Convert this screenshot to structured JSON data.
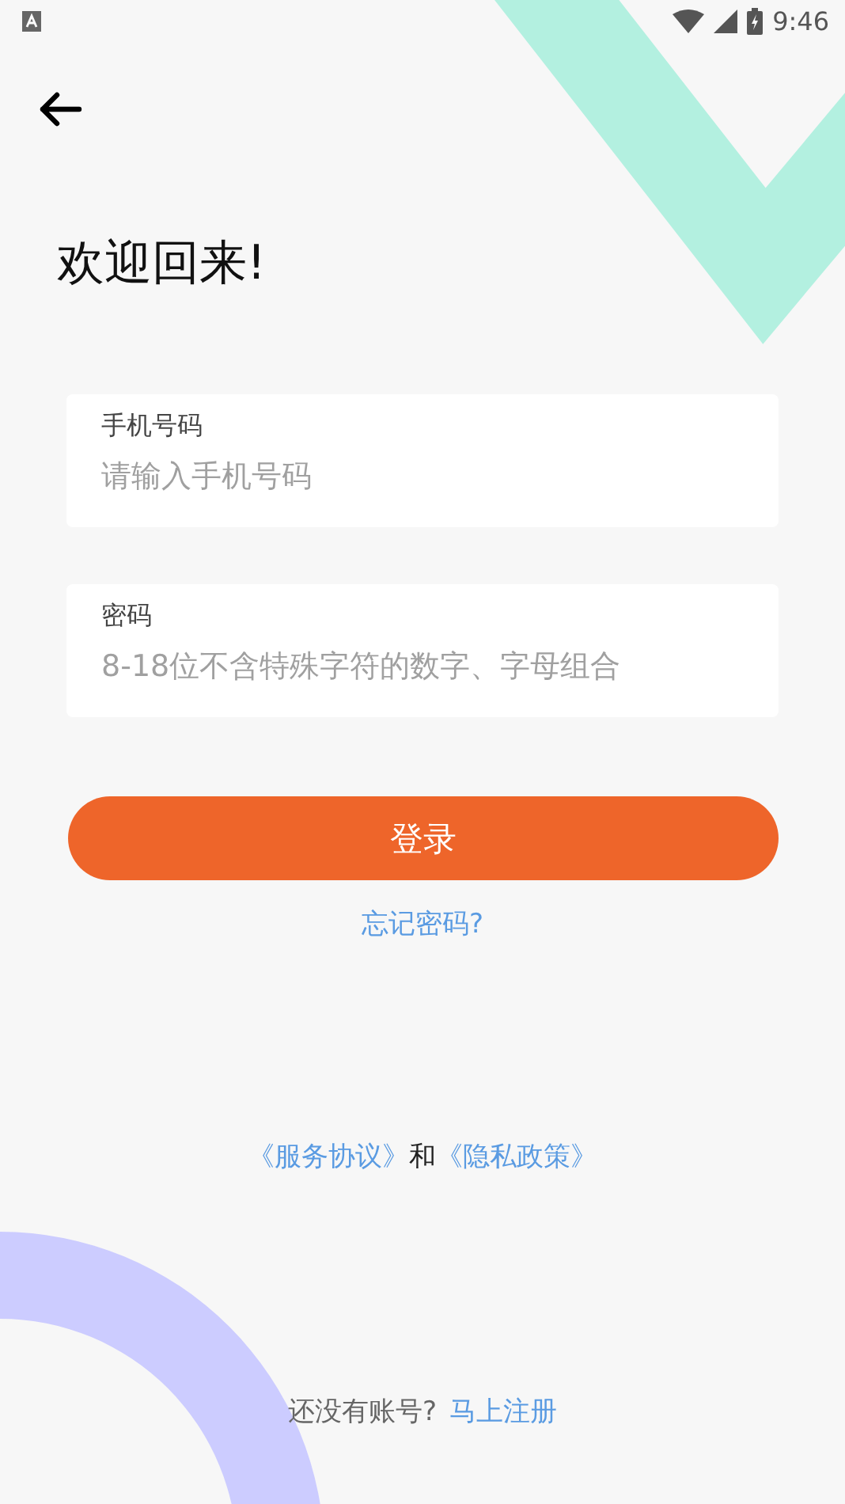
{
  "status_bar": {
    "time": "9:46"
  },
  "title": "欢迎回来!",
  "fields": [
    {
      "label": "手机号码",
      "placeholder": "请输入手机号码"
    },
    {
      "label": "密码",
      "placeholder": "8-18位不含特殊字符的数字、字母组合"
    }
  ],
  "login_button": "登录",
  "forgot_link": "忘记密码?",
  "terms": {
    "service": "《服务协议》",
    "and": "和",
    "privacy": "《隐私政策》"
  },
  "register": {
    "prompt": "还没有账号?",
    "link": "马上注册"
  }
}
